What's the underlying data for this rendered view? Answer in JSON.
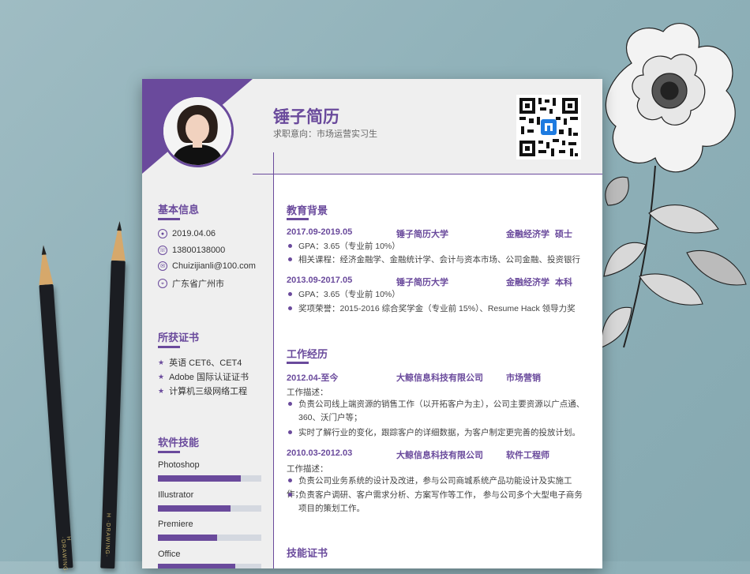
{
  "resume": {
    "name": "锤子简历",
    "intent": "求职意向：市场运营实习生",
    "colors": {
      "accent": "#6a4a9c",
      "sidebar_bg": "#efefef"
    },
    "sidebar": {
      "basic_title": "基本信息",
      "basic": [
        {
          "icon": "person-icon",
          "text": "2019.04.06"
        },
        {
          "icon": "phone-icon",
          "text": "13800138000"
        },
        {
          "icon": "email-icon",
          "text": "Chuizijianli@100.com"
        },
        {
          "icon": "location-icon",
          "text": "广东省广州市"
        }
      ],
      "cert_title": "所获证书",
      "certs": [
        "英语 CET6、CET4",
        "Adobe 国际认证证书",
        "计算机三级网络工程"
      ],
      "skills_title": "软件技能",
      "skills": [
        {
          "name": "Photoshop",
          "level": 0.8
        },
        {
          "name": "Illustrator",
          "level": 0.7
        },
        {
          "name": "Premiere",
          "level": 0.57
        },
        {
          "name": "Office",
          "level": 0.75
        }
      ]
    },
    "education": {
      "title": "教育背景",
      "entries": [
        {
          "date": "2017.09-2019.05",
          "school": "锤子简历大学",
          "major": "金融经济学",
          "degree": "硕士",
          "bullets": [
            "GPA：3.65（专业前 10%）",
            "相关课程：经济金融学、金融统计学、会计与资本市场、公司金融、投资银行"
          ]
        },
        {
          "date": "2013.09-2017.05",
          "school": "锤子简历大学",
          "major": "金融经济学",
          "degree": "本科",
          "bullets": [
            "GPA：3.65（专业前 10%）",
            "奖项荣誉：2015-2016 综合奖学金（专业前 15%）、Resume Hack 领导力奖"
          ]
        }
      ]
    },
    "work": {
      "title": "工作经历",
      "entries": [
        {
          "date": "2012.04-至今",
          "company": "大鲸信息科技有限公司",
          "role": "市场营销",
          "desc_label": "工作描述：",
          "bullets": [
            "负责公司线上端资源的销售工作（以开拓客户为主），公司主要资源以广点通、360、沃门户等；",
            "实时了解行业的变化，跟踪客户的详细数据，为客户制定更完善的投放计划。"
          ]
        },
        {
          "date": "2010.03-2012.03",
          "company": "大鲸信息科技有限公司",
          "role": "软件工程师",
          "desc_label": "工作描述：",
          "bullets": [
            "负责公司业务系统的设计及改进，参与公司商城系统产品功能设计及实施工作；",
            "负责客户调研、客户需求分析、方案写作等工作， 参与公司多个大型电子商务项目的策划工作。"
          ]
        }
      ]
    },
    "skills_cert_title": "技能证书"
  }
}
